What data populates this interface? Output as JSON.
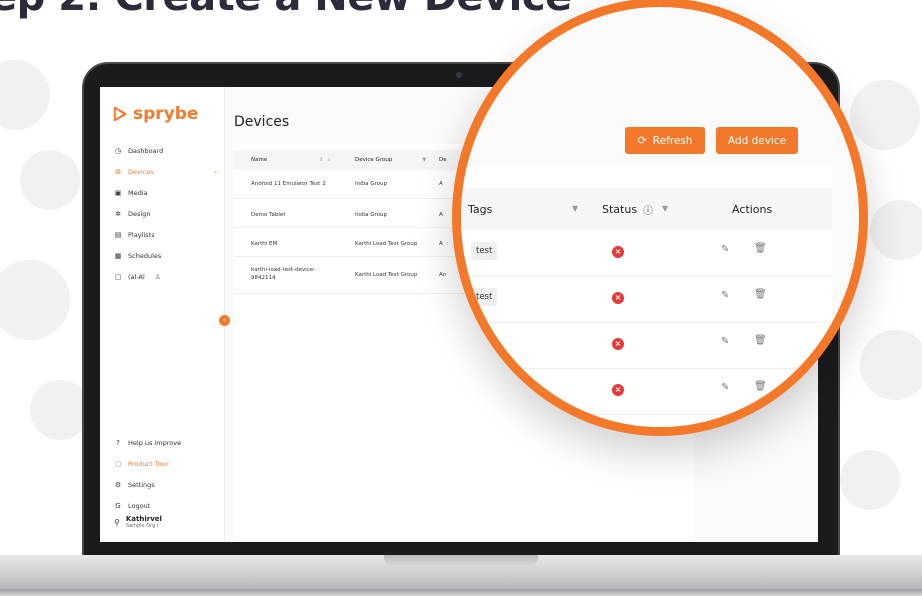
{
  "heading": "ep 2: Create a New Device",
  "app": {
    "logo_text": "sprybe",
    "page_title": "Devices"
  },
  "sidebar": {
    "items": [
      {
        "label": "Dashboard",
        "icon": "clock-icon"
      },
      {
        "label": "Devices",
        "icon": "devices-icon",
        "active": true
      },
      {
        "label": "Media",
        "icon": "image-icon"
      },
      {
        "label": "Design",
        "icon": "design-icon"
      },
      {
        "label": "Playlists",
        "icon": "playlist-icon"
      },
      {
        "label": "Schedules",
        "icon": "calendar-icon"
      },
      {
        "label": "(al-Al",
        "icon": "document-icon",
        "suffix": "♙"
      }
    ],
    "bottom_items": [
      {
        "label": "Help us improve",
        "icon": "help-icon"
      },
      {
        "label": "Product Tour",
        "icon": "tour-icon",
        "active": true
      },
      {
        "label": "Settings",
        "icon": "gear-icon"
      },
      {
        "label": "Logout",
        "icon": "logout-icon"
      }
    ],
    "user": {
      "name": "Kathirvel",
      "org": "Sample Org I"
    }
  },
  "table": {
    "headers": [
      "Name",
      "Device Group",
      "De"
    ],
    "rows": [
      {
        "name": "Android 11 Emulator Test 2",
        "group": "India Group",
        "extra": "A"
      },
      {
        "name": "Demo Tablet",
        "group": "India Group",
        "extra": "A"
      },
      {
        "name": "Karthi EM",
        "group": "Karthi Load Test Group",
        "extra": "A"
      },
      {
        "name": "karthi-load-test-device-\n9842114",
        "group": "Karthi Load Test Group",
        "extra": "An"
      }
    ]
  },
  "zoom": {
    "refresh_label": "Refresh",
    "add_device_label": "Add device",
    "headers": {
      "tags": "Tags",
      "status": "Status",
      "actions": "Actions"
    },
    "rows": [
      {
        "tag": "test",
        "status": "error"
      },
      {
        "tag": "test",
        "status": "error"
      },
      {
        "tag": "",
        "status": "error"
      },
      {
        "tag": "",
        "status": "error"
      }
    ]
  },
  "colors": {
    "accent": "#f4782a",
    "error": "#e53935"
  }
}
